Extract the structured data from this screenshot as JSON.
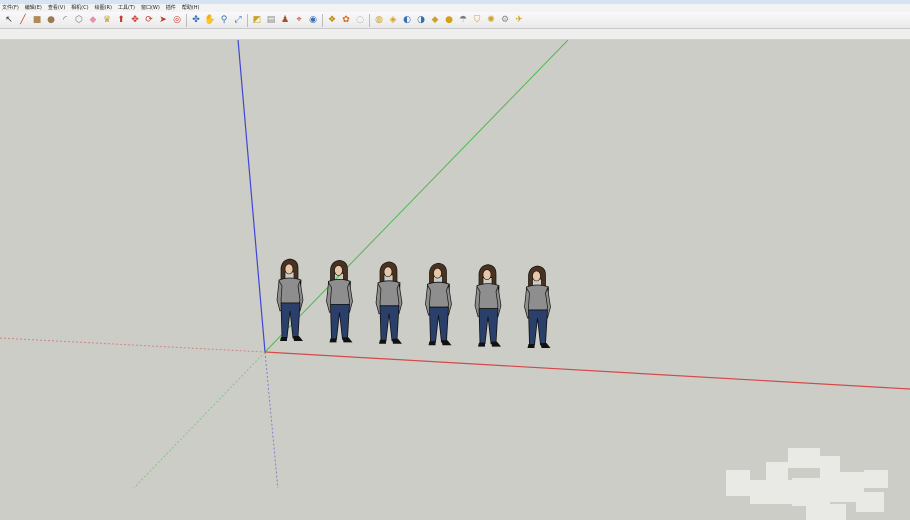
{
  "menu": [
    {
      "label": "文件(F)"
    },
    {
      "label": "编辑(E)"
    },
    {
      "label": "查看(V)"
    },
    {
      "label": "相机(C)"
    },
    {
      "label": "绘图(R)"
    },
    {
      "label": "工具(T)"
    },
    {
      "label": "窗口(W)"
    },
    {
      "label": "插件"
    },
    {
      "label": "帮助(H)"
    }
  ],
  "toolbar": {
    "groups": [
      [
        {
          "icon": "select-arrow-icon",
          "glyph": "↖",
          "color": "#333333"
        },
        {
          "icon": "pencil-line-icon",
          "glyph": "╱",
          "color": "#c0392b"
        },
        {
          "icon": "rectangle-icon",
          "glyph": "■",
          "color": "#b08a5a"
        },
        {
          "icon": "circle-icon",
          "glyph": "●",
          "color": "#9a7a55"
        },
        {
          "icon": "arc-icon",
          "glyph": "◜",
          "color": "#555555"
        },
        {
          "icon": "polygon-icon",
          "glyph": "⬡",
          "color": "#777777"
        },
        {
          "icon": "eraser-icon",
          "glyph": "◆",
          "color": "#e58fa8"
        },
        {
          "icon": "paint-bucket-icon",
          "glyph": "♛",
          "color": "#c9a227"
        },
        {
          "icon": "push-pull-icon",
          "glyph": "⬆",
          "color": "#c0392b"
        },
        {
          "icon": "move-icon",
          "glyph": "✥",
          "color": "#c0392b"
        },
        {
          "icon": "rotate-icon",
          "glyph": "⟳",
          "color": "#c0392b"
        },
        {
          "icon": "follow-me-icon",
          "glyph": "➤",
          "color": "#c0392b"
        },
        {
          "icon": "offset-icon",
          "glyph": "◎",
          "color": "#c0392b"
        }
      ],
      [
        {
          "icon": "orbit-icon",
          "glyph": "✤",
          "color": "#3b6fb6"
        },
        {
          "icon": "pan-icon",
          "glyph": "✋",
          "color": "#555555"
        },
        {
          "icon": "zoom-icon",
          "glyph": "⚲",
          "color": "#3b6fb6"
        },
        {
          "icon": "zoom-extents-icon",
          "glyph": "⤢",
          "color": "#3b6fb6"
        }
      ],
      [
        {
          "icon": "tape-measure-icon",
          "glyph": "◩",
          "color": "#c9a227"
        },
        {
          "icon": "dimension-icon",
          "glyph": "▤",
          "color": "#888888"
        },
        {
          "icon": "walk-icon",
          "glyph": "♟",
          "color": "#a0522d"
        },
        {
          "icon": "position-camera-icon",
          "glyph": "⌖",
          "color": "#c0392b"
        },
        {
          "icon": "look-around-icon",
          "glyph": "◉",
          "color": "#3b6fb6"
        }
      ],
      [
        {
          "icon": "component-icon",
          "glyph": "❖",
          "color": "#b8860b"
        },
        {
          "icon": "material-icon",
          "glyph": "✿",
          "color": "#d2691e"
        },
        {
          "icon": "style-icon",
          "glyph": "◌",
          "color": "#999999"
        }
      ],
      [
        {
          "icon": "google-earth-icon",
          "glyph": "◍",
          "color": "#c9a227"
        },
        {
          "icon": "get-models-icon",
          "glyph": "◈",
          "color": "#d4a017"
        },
        {
          "icon": "share-model-icon",
          "glyph": "◐",
          "color": "#3b6fb6"
        },
        {
          "icon": "globe-icon",
          "glyph": "◑",
          "color": "#2f6fa6"
        },
        {
          "icon": "layer-icon",
          "glyph": "◆",
          "color": "#c9a227"
        },
        {
          "icon": "shadow-icon",
          "glyph": "●",
          "color": "#d4a017"
        },
        {
          "icon": "fog-icon",
          "glyph": "☂",
          "color": "#777777"
        },
        {
          "icon": "section-plane-icon",
          "glyph": "⛉",
          "color": "#c9a227"
        },
        {
          "icon": "sun-icon",
          "glyph": "✺",
          "color": "#c9a227"
        },
        {
          "icon": "settings-icon",
          "glyph": "⚙",
          "color": "#888888"
        },
        {
          "icon": "extension-icon",
          "glyph": "✈",
          "color": "#c9a227"
        }
      ]
    ]
  },
  "scene": {
    "background": "#cdcdc8",
    "axis_colors": {
      "blue": "#3f46d4",
      "green": "#4fb84f",
      "red": "#d24a4a"
    },
    "figure_count": 6,
    "figure_colors": {
      "hair": "#4a3220",
      "shirt": "#8e8e8e",
      "jeans": "#2a3f6a",
      "skin": "#e8c6a8",
      "outline": "#111111"
    }
  }
}
